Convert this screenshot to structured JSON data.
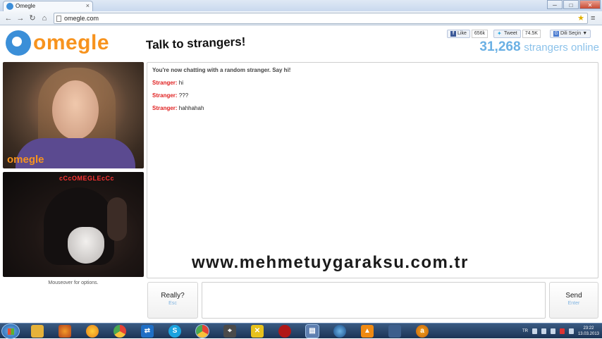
{
  "browser": {
    "tab_title": "Omegle",
    "tab_close": "×",
    "window_controls": {
      "minimize": "─",
      "maximize": "□",
      "close": "✕"
    },
    "nav": {
      "back": "←",
      "forward": "→",
      "reload": "↻",
      "home": "⌂"
    },
    "address": "omegle.com",
    "star_icon": "star-icon",
    "wrench_icon": "wrench-icon"
  },
  "header": {
    "logo_text": "omegle",
    "tagline": "Talk to strangers!",
    "social": {
      "like_label": "Like",
      "like_count": "656k",
      "tweet_label": "Tweet",
      "tweet_count": "74.5K",
      "lang_label": "Dili Seçin",
      "lang_arrow": "▼"
    },
    "online_count": "31,268",
    "online_label": "strangers online"
  },
  "video": {
    "stranger_watermark": "omegle",
    "self_caption": "cCcOMEGLEcCc",
    "mouseover_hint": "Mouseover for options."
  },
  "chat": {
    "status": "You're now chatting with a random stranger. Say hi!",
    "messages": [
      {
        "who": "Stranger:",
        "text": "hi"
      },
      {
        "who": "Stranger:",
        "text": "???"
      },
      {
        "who": "Stranger:",
        "text": "hahhahah"
      }
    ]
  },
  "overlay_watermark": "www.mehmetuygaraksu.com.tr",
  "controls": {
    "disconnect_label": "Really?",
    "disconnect_key": "Esc",
    "send_label": "Send",
    "send_key": "Enter",
    "message_value": ""
  },
  "taskbar": {
    "apps": [
      "explorer",
      "firefox",
      "media",
      "chrome-like",
      "teamviewer",
      "skype",
      "chrome",
      "counter-strike",
      "utility",
      "game",
      "save",
      "media-center",
      "vlc",
      "tool",
      "avast"
    ],
    "tray_lang": "TR",
    "time": "23:22",
    "date": "13.03.2013"
  },
  "colors": {
    "omegle_orange": "#f7931e",
    "omegle_blue": "#3b8fd8",
    "stranger_red": "#e02020",
    "online_blue": "#6ab0e4"
  }
}
